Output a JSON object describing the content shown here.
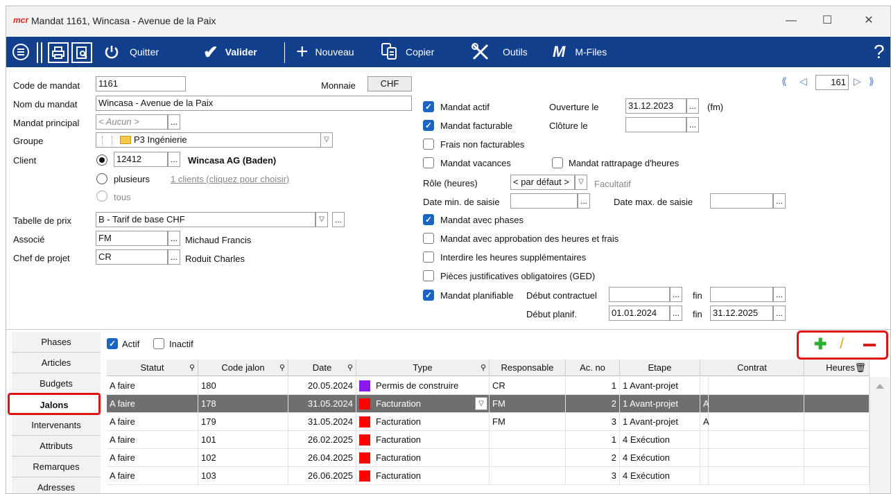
{
  "window": {
    "logo": "mcr",
    "title": "Mandat 1161, Wincasa - Avenue de la Paix"
  },
  "toolbar": {
    "quit": "Quitter",
    "validate": "Valider",
    "new": "Nouveau",
    "copy": "Copier",
    "tools": "Outils",
    "mfiles_icon": "M",
    "mfiles": "M-Files",
    "help": "?"
  },
  "nav": {
    "page": "161"
  },
  "form": {
    "code_label": "Code de mandat",
    "code": "1161",
    "currency_label": "Monnaie",
    "currency": "CHF",
    "name_label": "Nom du mandat",
    "name": "Wincasa - Avenue de la Paix",
    "parent_label": "Mandat principal",
    "parent": "< Aucun >",
    "group_label": "Groupe",
    "group": "P3 Ingénierie",
    "client_label": "Client",
    "client_code": "12412",
    "client_name": "Wincasa AG (Baden)",
    "plusieurs": "plusieurs",
    "clients_link": "1 clients (cliquez pour choisir)",
    "tous": "tous",
    "price_label": "Tabelle de prix",
    "price": "B - Tarif de base CHF",
    "assoc_label": "Associé",
    "assoc_code": "FM",
    "assoc_name": "Michaud Francis",
    "pm_label": "Chef de projet",
    "pm_code": "CR",
    "pm_name": "Roduit Charles"
  },
  "options": {
    "actif": "Mandat actif",
    "facturable": "Mandat facturable",
    "frais": "Frais non facturables",
    "vacances": "Mandat vacances",
    "rattrapage": "Mandat rattrapage d'heures",
    "ouverture_label": "Ouverture le",
    "ouverture": "31.12.2023",
    "fm": "(fm)",
    "cloture_label": "Clôture le",
    "role_label": "Rôle (heures)",
    "role": "< par défaut >",
    "facultatif": "Facultatif",
    "datemin_label": "Date min. de saisie",
    "datemax_label": "Date max. de saisie",
    "phases": "Mandat avec phases",
    "approbation": "Mandat avec approbation des heures et frais",
    "supp": "Interdire les heures supplémentaires",
    "pieces": "Pièces justificatives obligatoires (GED)",
    "planifiable": "Mandat planifiable",
    "debut_contr_label": "Début contractuel",
    "fin_label": "fin",
    "debut_plan_label": "Début planif.",
    "debut_plan": "01.01.2024",
    "fin_plan": "31.12.2025"
  },
  "tabs": [
    "Phases",
    "Articles",
    "Budgets",
    "Jalons",
    "Intervenants",
    "Attributs",
    "Remarques",
    "Adresses"
  ],
  "filter": {
    "actif": "Actif",
    "inactif": "Inactif"
  },
  "grid": {
    "headers": [
      "Statut",
      "Code jalon",
      "Date",
      "Type",
      "Responsable",
      "Ac. no",
      "Etape",
      "Contrat",
      "Heures"
    ],
    "rows": [
      {
        "statut": "A faire",
        "code": "180",
        "date": "20.05.2024",
        "color": "#8a18f0",
        "type": "Permis de construire",
        "resp": "CR",
        "acno": "1",
        "etape": "1 Avant-projet",
        "flag": ""
      },
      {
        "statut": "A faire",
        "code": "178",
        "date": "31.05.2024",
        "color": "#ff0000",
        "type": "Facturation",
        "resp": "FM",
        "acno": "2",
        "etape": "1 Avant-projet",
        "flag": "A"
      },
      {
        "statut": "A faire",
        "code": "179",
        "date": "31.05.2024",
        "color": "#ff0000",
        "type": "Facturation",
        "resp": "FM",
        "acno": "3",
        "etape": "1 Avant-projet",
        "flag": "A"
      },
      {
        "statut": "A faire",
        "code": "101",
        "date": "26.02.2025",
        "color": "#ff0000",
        "type": "Facturation",
        "resp": "",
        "acno": "1",
        "etape": "4 Exécution",
        "flag": ""
      },
      {
        "statut": "A faire",
        "code": "102",
        "date": "26.04.2025",
        "color": "#ff0000",
        "type": "Facturation",
        "resp": "",
        "acno": "2",
        "etape": "4 Exécution",
        "flag": ""
      },
      {
        "statut": "A faire",
        "code": "103",
        "date": "26.06.2025",
        "color": "#ff0000",
        "type": "Facturation",
        "resp": "",
        "acno": "3",
        "etape": "4 Exécution",
        "flag": ""
      }
    ]
  }
}
